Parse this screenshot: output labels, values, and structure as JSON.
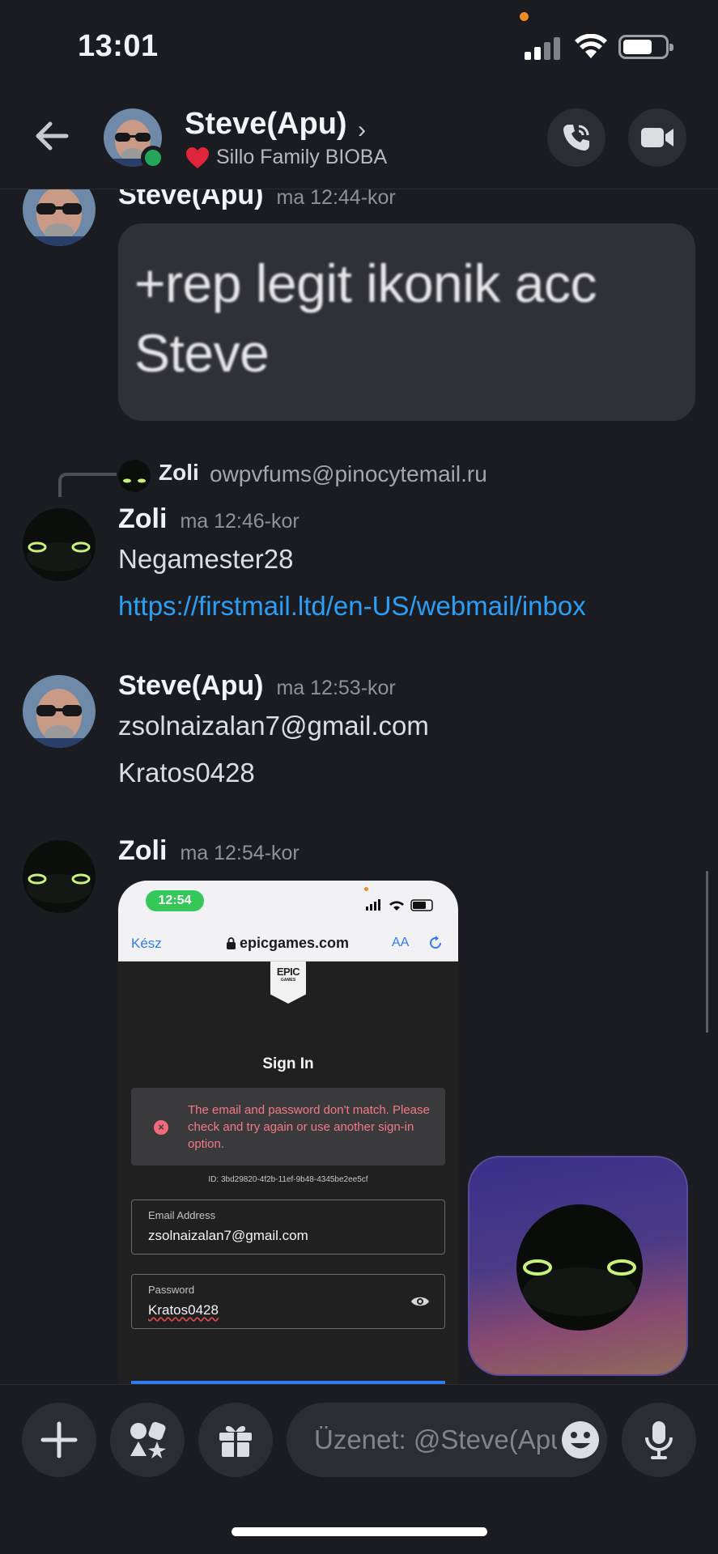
{
  "status_bar": {
    "time": "13:01"
  },
  "header": {
    "title": "Steve(Apu)",
    "subtitle": "Sillo Family BIOBA"
  },
  "messages": [
    {
      "author": "Steve(Apu)",
      "timestamp": "ma 12:44-kor",
      "image_text": [
        "+rep legit ikonik acc",
        "Steve"
      ]
    },
    {
      "reply": {
        "author": "Zoli",
        "text": "owpvfums@pinocytemail.ru"
      },
      "author": "Zoli",
      "timestamp": "ma 12:46-kor",
      "lines": [
        "Negamester28",
        "https://firstmail.ltd/en-US/webmail/inbox"
      ]
    },
    {
      "author": "Steve(Apu)",
      "timestamp": "ma 12:53-kor",
      "lines": [
        "zsolnaizalan7@gmail.com",
        "Kratos0428"
      ]
    },
    {
      "author": "Zoli",
      "timestamp": "ma 12:54-kor"
    }
  ],
  "screenshot": {
    "time": "12:54",
    "done": "Kész",
    "url": "epicgames.com",
    "aa": "AA",
    "logo_top": "EPIC",
    "logo_bottom": "GAMES",
    "title": "Sign In",
    "error": "The email and password don't match. Please check and try again or use another sign-in option.",
    "id": "ID: 3bd29820-4f2b-11ef-9b48-4345be2ee5cf",
    "email_label": "Email Address",
    "email_value": "zsolnaizalan7@gmail.com",
    "password_label": "Password",
    "password_value": "Kratos0428"
  },
  "composer": {
    "placeholder": "Üzenet: @Steve(Apu)"
  },
  "colors": {
    "accent_link": "#2a9ff5",
    "online": "#23a55a",
    "background": "#1b1c22"
  }
}
